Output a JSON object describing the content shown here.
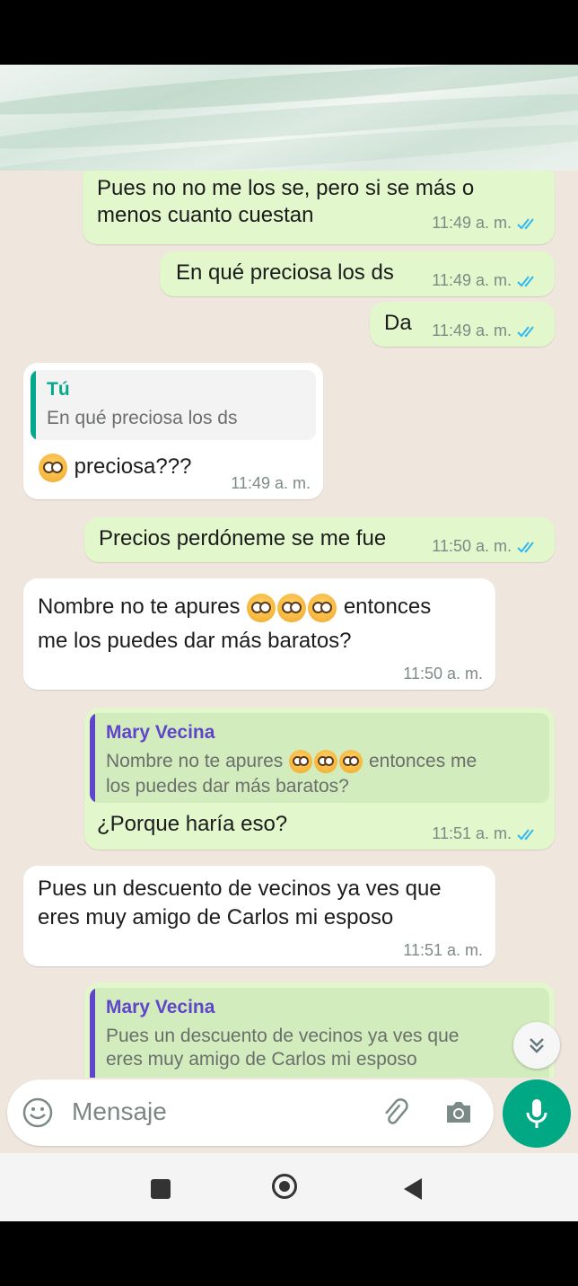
{
  "messages": [
    {
      "lines": [
        "Pues no no me los se, pero si se más o",
        "menos cuanto cuestan"
      ],
      "time": "11:49 a. m."
    },
    {
      "lines": [
        "En qué preciosa los ds"
      ],
      "time": "11:49 a. m."
    },
    {
      "lines": [
        "Da"
      ],
      "time": "11:49 a. m."
    },
    {
      "quote_name": "Tú",
      "quote_text": "En qué preciosa los ds",
      "text": "preciosa???",
      "time": "11:49 a. m."
    },
    {
      "lines": [
        "Precios perdóneme se me fue"
      ],
      "time": "11:50 a. m."
    },
    {
      "line1_before": "Nombre no te apures",
      "line1_after": "entonces",
      "line2": "me los puedes dar más baratos?",
      "time": "11:50 a. m."
    },
    {
      "quote_name": "Mary Vecina",
      "quote_line1_before": "Nombre no te apures",
      "quote_line1_after": "entonces me",
      "quote_line2": "los puedes dar más baratos?",
      "text": "¿Porque haría eso?",
      "time": "11:51 a. m."
    },
    {
      "lines": [
        "Pues un descuento de vecinos ya ves que",
        "eres muy amigo de Carlos mi esposo"
      ],
      "time": "11:51 a. m."
    },
    {
      "quote_name": "Mary Vecina",
      "quote_lines": [
        "Pues un descuento de vecinos ya ves que",
        "eres muy amigo de Carlos mi esposo"
      ]
    }
  ],
  "composer": {
    "placeholder": "Mensaje"
  },
  "icons": {
    "emoji": "emoji-icon",
    "attach": "paperclip-icon",
    "camera": "camera-icon",
    "mic": "mic-icon",
    "scroll": "double-chevron-down-icon",
    "nav_recents": "square-icon",
    "nav_home": "circle-icon",
    "nav_back": "triangle-back-icon"
  },
  "colors": {
    "outgoing": "#e2f7cb",
    "incoming": "#ffffff",
    "accent": "#00a884",
    "tick": "#34b7f1",
    "quote_you": "#06a88c",
    "quote_other": "#5f45c9"
  }
}
